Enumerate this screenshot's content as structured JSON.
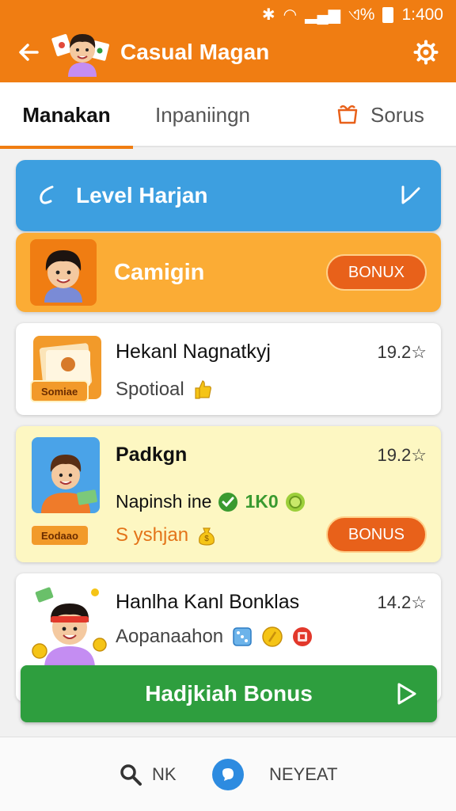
{
  "status_bar": {
    "signal_text": "ଏ%",
    "time": "1:400"
  },
  "header": {
    "title": "Casual Magan"
  },
  "tabs": [
    {
      "label": "Manakan",
      "active": true
    },
    {
      "label": "Inpaniingn",
      "active": false
    },
    {
      "label": "Sorus",
      "active": false,
      "icon": "gift-icon"
    }
  ],
  "level_banner": {
    "label": "Level Harjan",
    "icon": "swirl-icon",
    "action_icon": "edit-icon"
  },
  "campaign": {
    "label": "Camigin",
    "button_label": "BONUX"
  },
  "games": [
    {
      "title": "Hekanl Nagnatkyj",
      "rating": "19.2☆",
      "subtitle": "Spotioal",
      "ribbon": "Somiae",
      "icon": "thumbs-up-icon"
    },
    {
      "title": "Padkgn",
      "rating": "19.2☆",
      "meta_text": "Napinsh ine",
      "meta_value": "1K0",
      "subtitle": "S yshjan",
      "ribbon": "Eodaao",
      "button_label": "BONUS"
    },
    {
      "title": "Hanlha Kanl Bonklas",
      "rating": "14.2☆",
      "subtitle": "Aopanaahon"
    }
  ],
  "claim_button": {
    "label": "Hadjkiah Bonus"
  },
  "bottom_nav": {
    "search_label": "NK",
    "next_label": "NEYEAT"
  },
  "colors": {
    "primary": "#f07d12",
    "blue": "#3d9fe0",
    "campaign": "#fbac35",
    "green": "#2e9e3e",
    "bonus": "#e8611a"
  }
}
